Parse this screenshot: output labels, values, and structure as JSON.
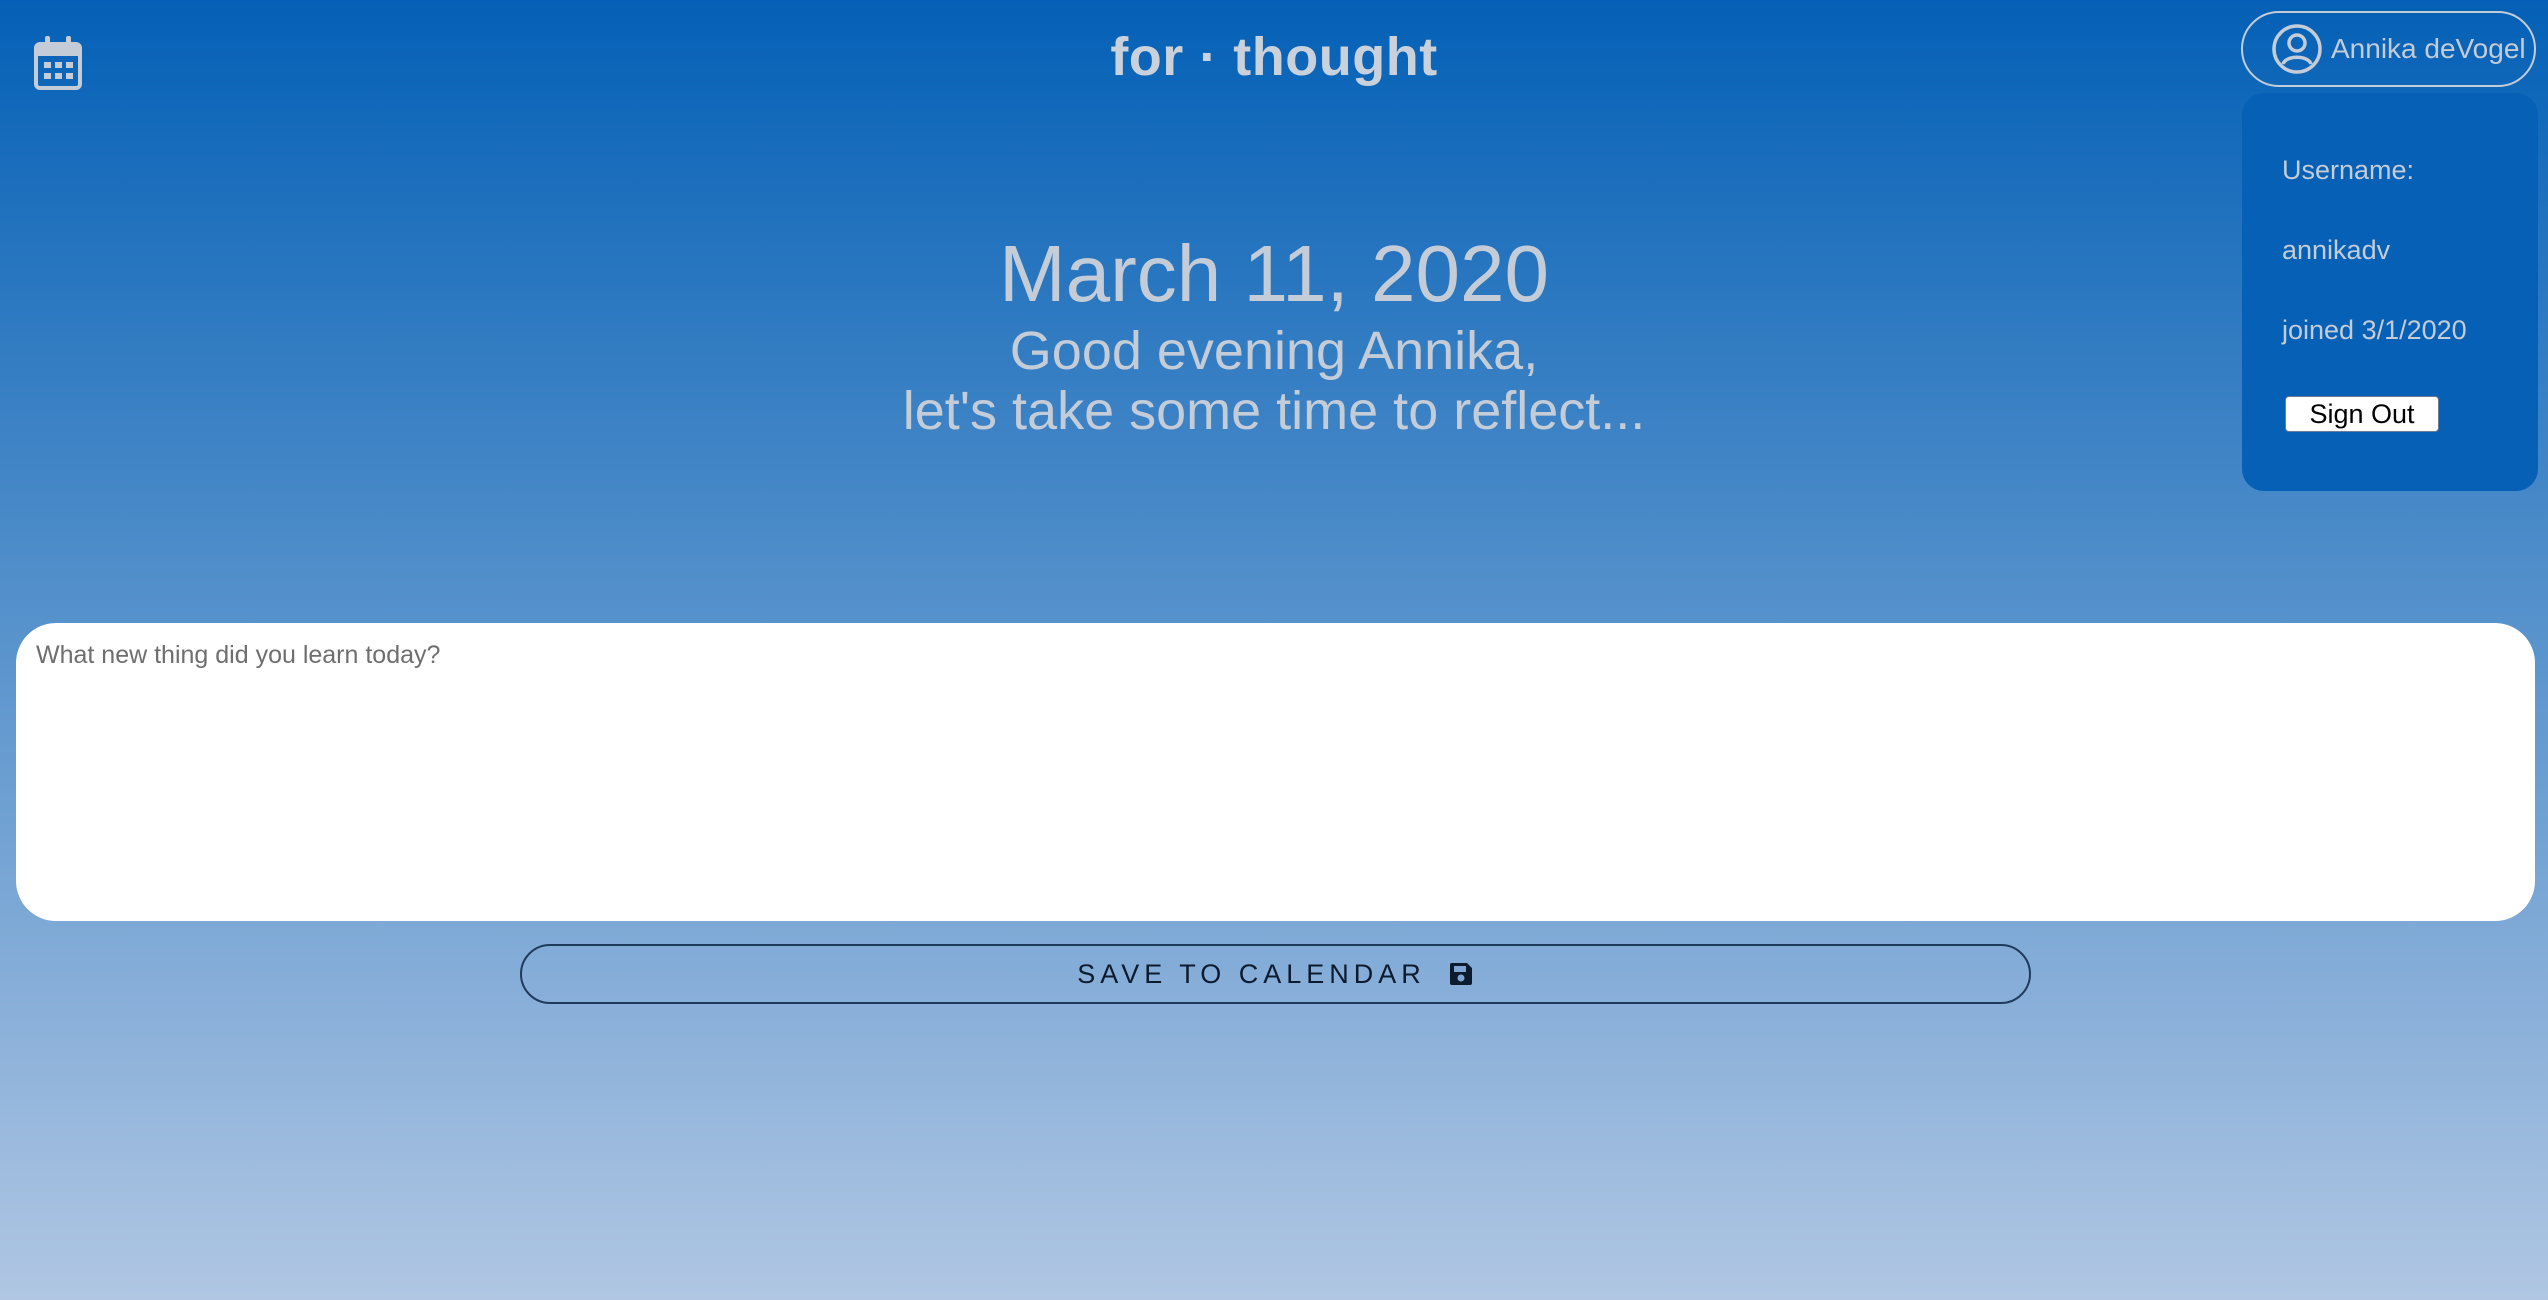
{
  "header": {
    "title": "for · thought",
    "calendar_icon": "calendar-icon",
    "user_button": {
      "icon": "user-circle-icon",
      "name": "Annika deVogel"
    }
  },
  "user_panel": {
    "username_label": "Username:",
    "username": "annikadv",
    "joined": "joined 3/1/2020",
    "sign_out_label": "Sign Out"
  },
  "main": {
    "date": "March 11, 2020",
    "greeting_line1": "Good evening Annika,",
    "greeting_line2": "let's take some time to reflect...",
    "entry_placeholder": "What new thing did you learn today?",
    "entry_value": ""
  },
  "save_button": {
    "label": "SAVE TO CALENDAR",
    "icon": "floppy-disk-icon"
  },
  "colors": {
    "gradient_top": "#0460b6",
    "gradient_bottom": "#b0c6e3",
    "panel_bg": "#0661b6",
    "text_muted": "#c4ccd8"
  }
}
